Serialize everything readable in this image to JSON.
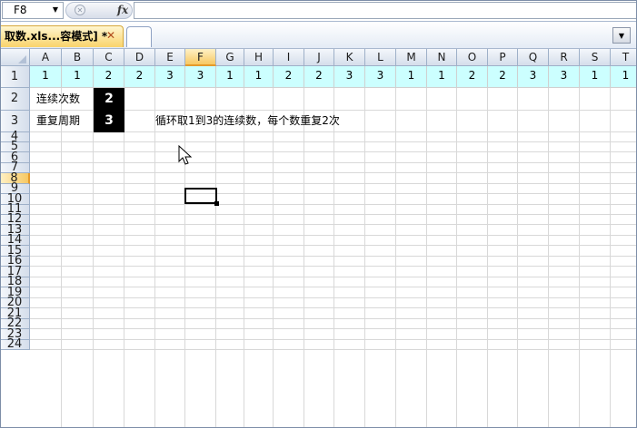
{
  "formula_bar": {
    "name_box": "F8",
    "fx_label": "fx",
    "formula": ""
  },
  "tabs": {
    "workbook_label": "取数.xls...容模式] *",
    "close_glyph": "✕"
  },
  "columns": [
    "A",
    "B",
    "C",
    "D",
    "E",
    "F",
    "G",
    "H",
    "I",
    "J",
    "K",
    "L",
    "M",
    "N",
    "O",
    "P",
    "Q",
    "R",
    "S",
    "T"
  ],
  "rows": [
    "1",
    "2",
    "3",
    "4",
    "5",
    "6",
    "7",
    "8",
    "9",
    "10",
    "11",
    "12",
    "13",
    "14",
    "15",
    "16",
    "17",
    "18",
    "19",
    "20",
    "21",
    "22",
    "23",
    "24"
  ],
  "active_cell": {
    "column": "F",
    "row": "8"
  },
  "row1_values": [
    "1",
    "1",
    "2",
    "2",
    "3",
    "3",
    "1",
    "1",
    "2",
    "2",
    "3",
    "3",
    "1",
    "1",
    "2",
    "2",
    "3",
    "3",
    "1",
    "1"
  ],
  "labels": {
    "repeat_count": "连续次数",
    "repeat_period": "重复周期"
  },
  "values": {
    "repeat_count": "2",
    "repeat_period": "3"
  },
  "note": "循环取1到3的连续数，每个数重复2次",
  "colors": {
    "row1_fill": "#ccffff",
    "value_cell_fill": "#000000",
    "active_header": "#f7c862"
  },
  "icons": {
    "cursor": "arrow-pointer-icon",
    "fx": "function-icon",
    "close": "close-icon",
    "dropdown": "chevron-down-icon"
  }
}
